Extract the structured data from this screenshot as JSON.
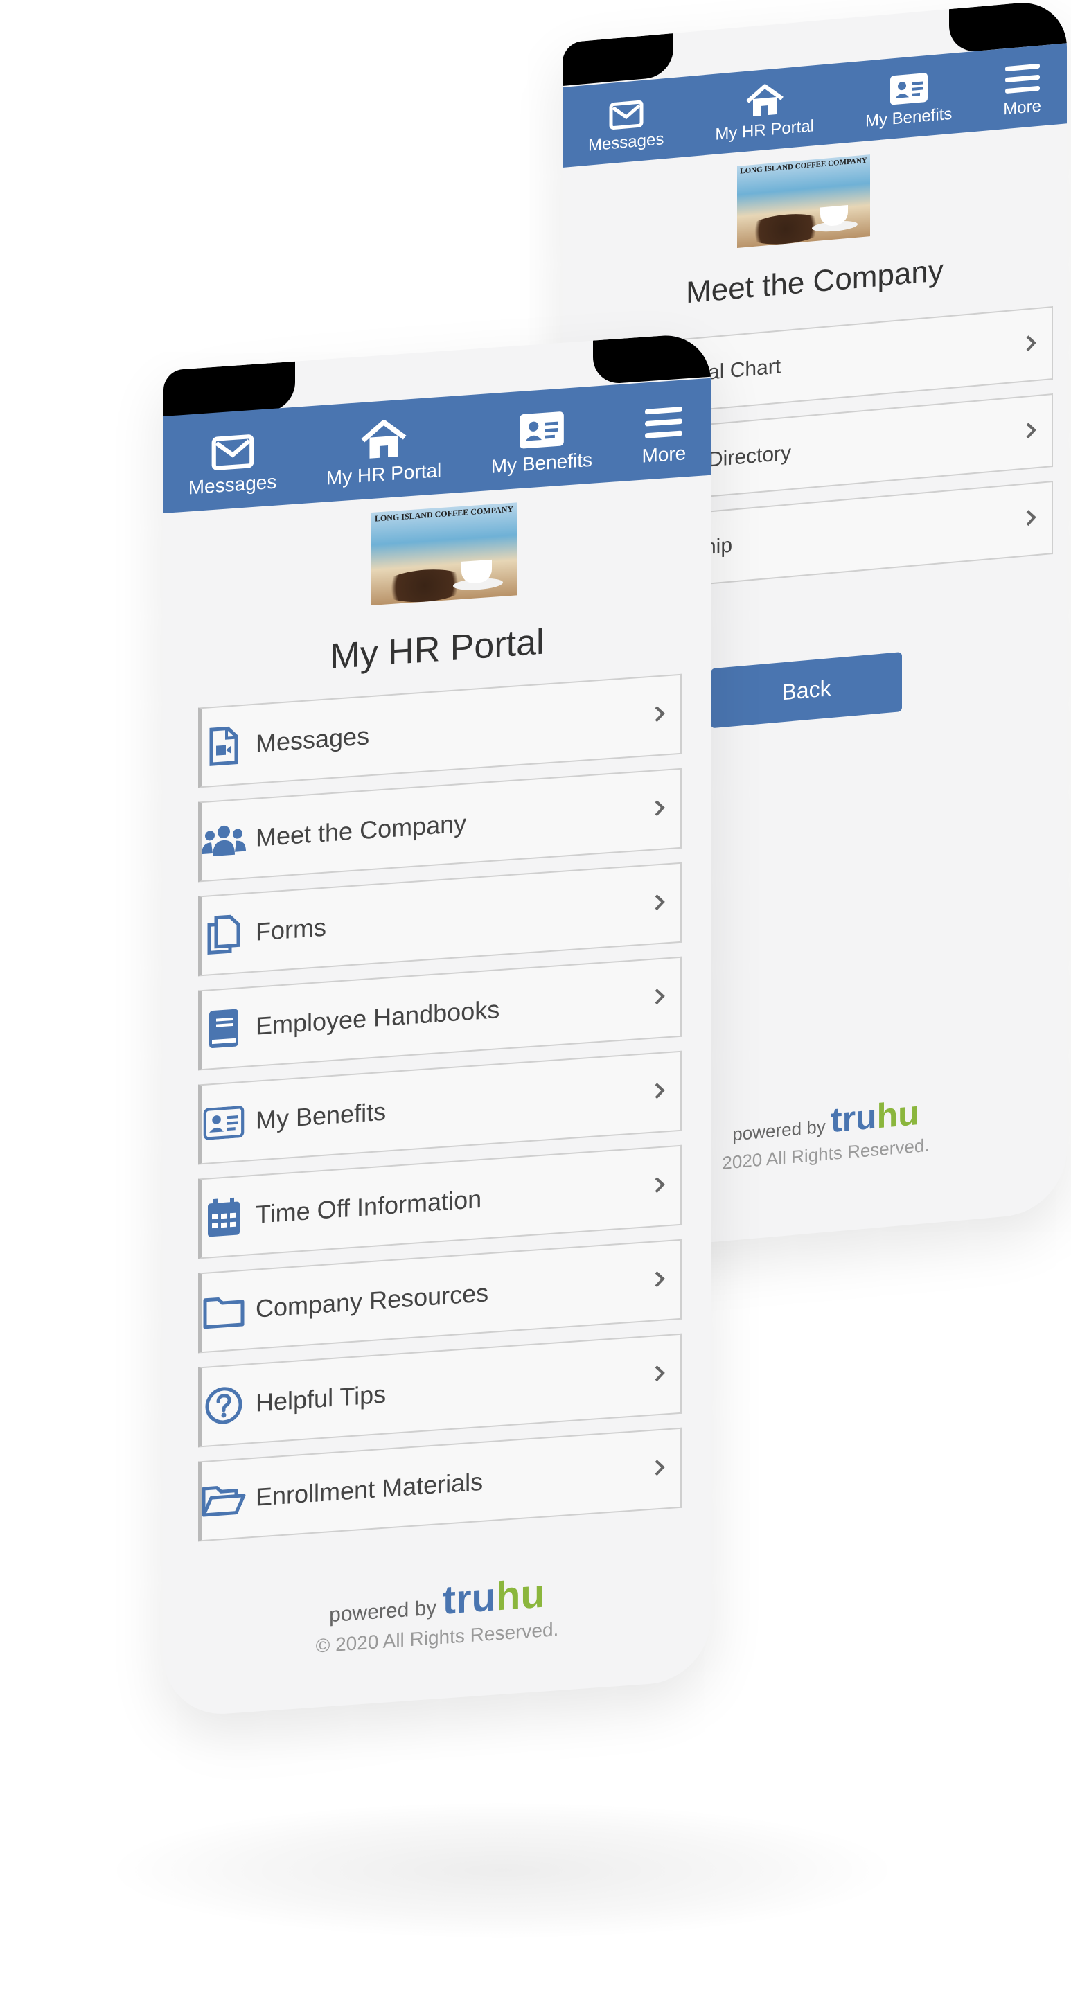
{
  "nav": {
    "messages": "Messages",
    "hr_portal": "My HR Portal",
    "benefits": "My Benefits",
    "more": "More"
  },
  "logo": {
    "text": "LONG ISLAND COFFEE COMPANY"
  },
  "back_screen": {
    "title": "Meet the Company",
    "items": [
      {
        "label": "ational Chart"
      },
      {
        "label": "e Directory"
      },
      {
        "label": "hip"
      }
    ],
    "back_button": "Back",
    "powered_by": "powered by",
    "brand_a": "tru",
    "brand_b": "hu",
    "copyright": "2020 All Rights Reserved."
  },
  "front_screen": {
    "title": "My HR Portal",
    "items": [
      {
        "label": "Messages",
        "icon": "video-file-icon"
      },
      {
        "label": "Meet the Company",
        "icon": "users-icon"
      },
      {
        "label": "Forms",
        "icon": "copy-documents-icon"
      },
      {
        "label": "Employee Handbooks",
        "icon": "book-icon"
      },
      {
        "label": "My Benefits",
        "icon": "id-card-icon"
      },
      {
        "label": "Time Off Information",
        "icon": "calendar-icon"
      },
      {
        "label": "Company Resources",
        "icon": "folder-icon"
      },
      {
        "label": "Helpful Tips",
        "icon": "question-circle-icon"
      },
      {
        "label": "Enrollment Materials",
        "icon": "folder-open-icon"
      }
    ],
    "powered_by": "powered by",
    "brand_a": "tru",
    "brand_b": "hu",
    "copyright": "© 2020 All Rights Reserved."
  },
  "colors": {
    "nav_blue": "#4a75b0",
    "brand_green": "#8bb63d",
    "screen_bg": "#f4f4f5"
  }
}
